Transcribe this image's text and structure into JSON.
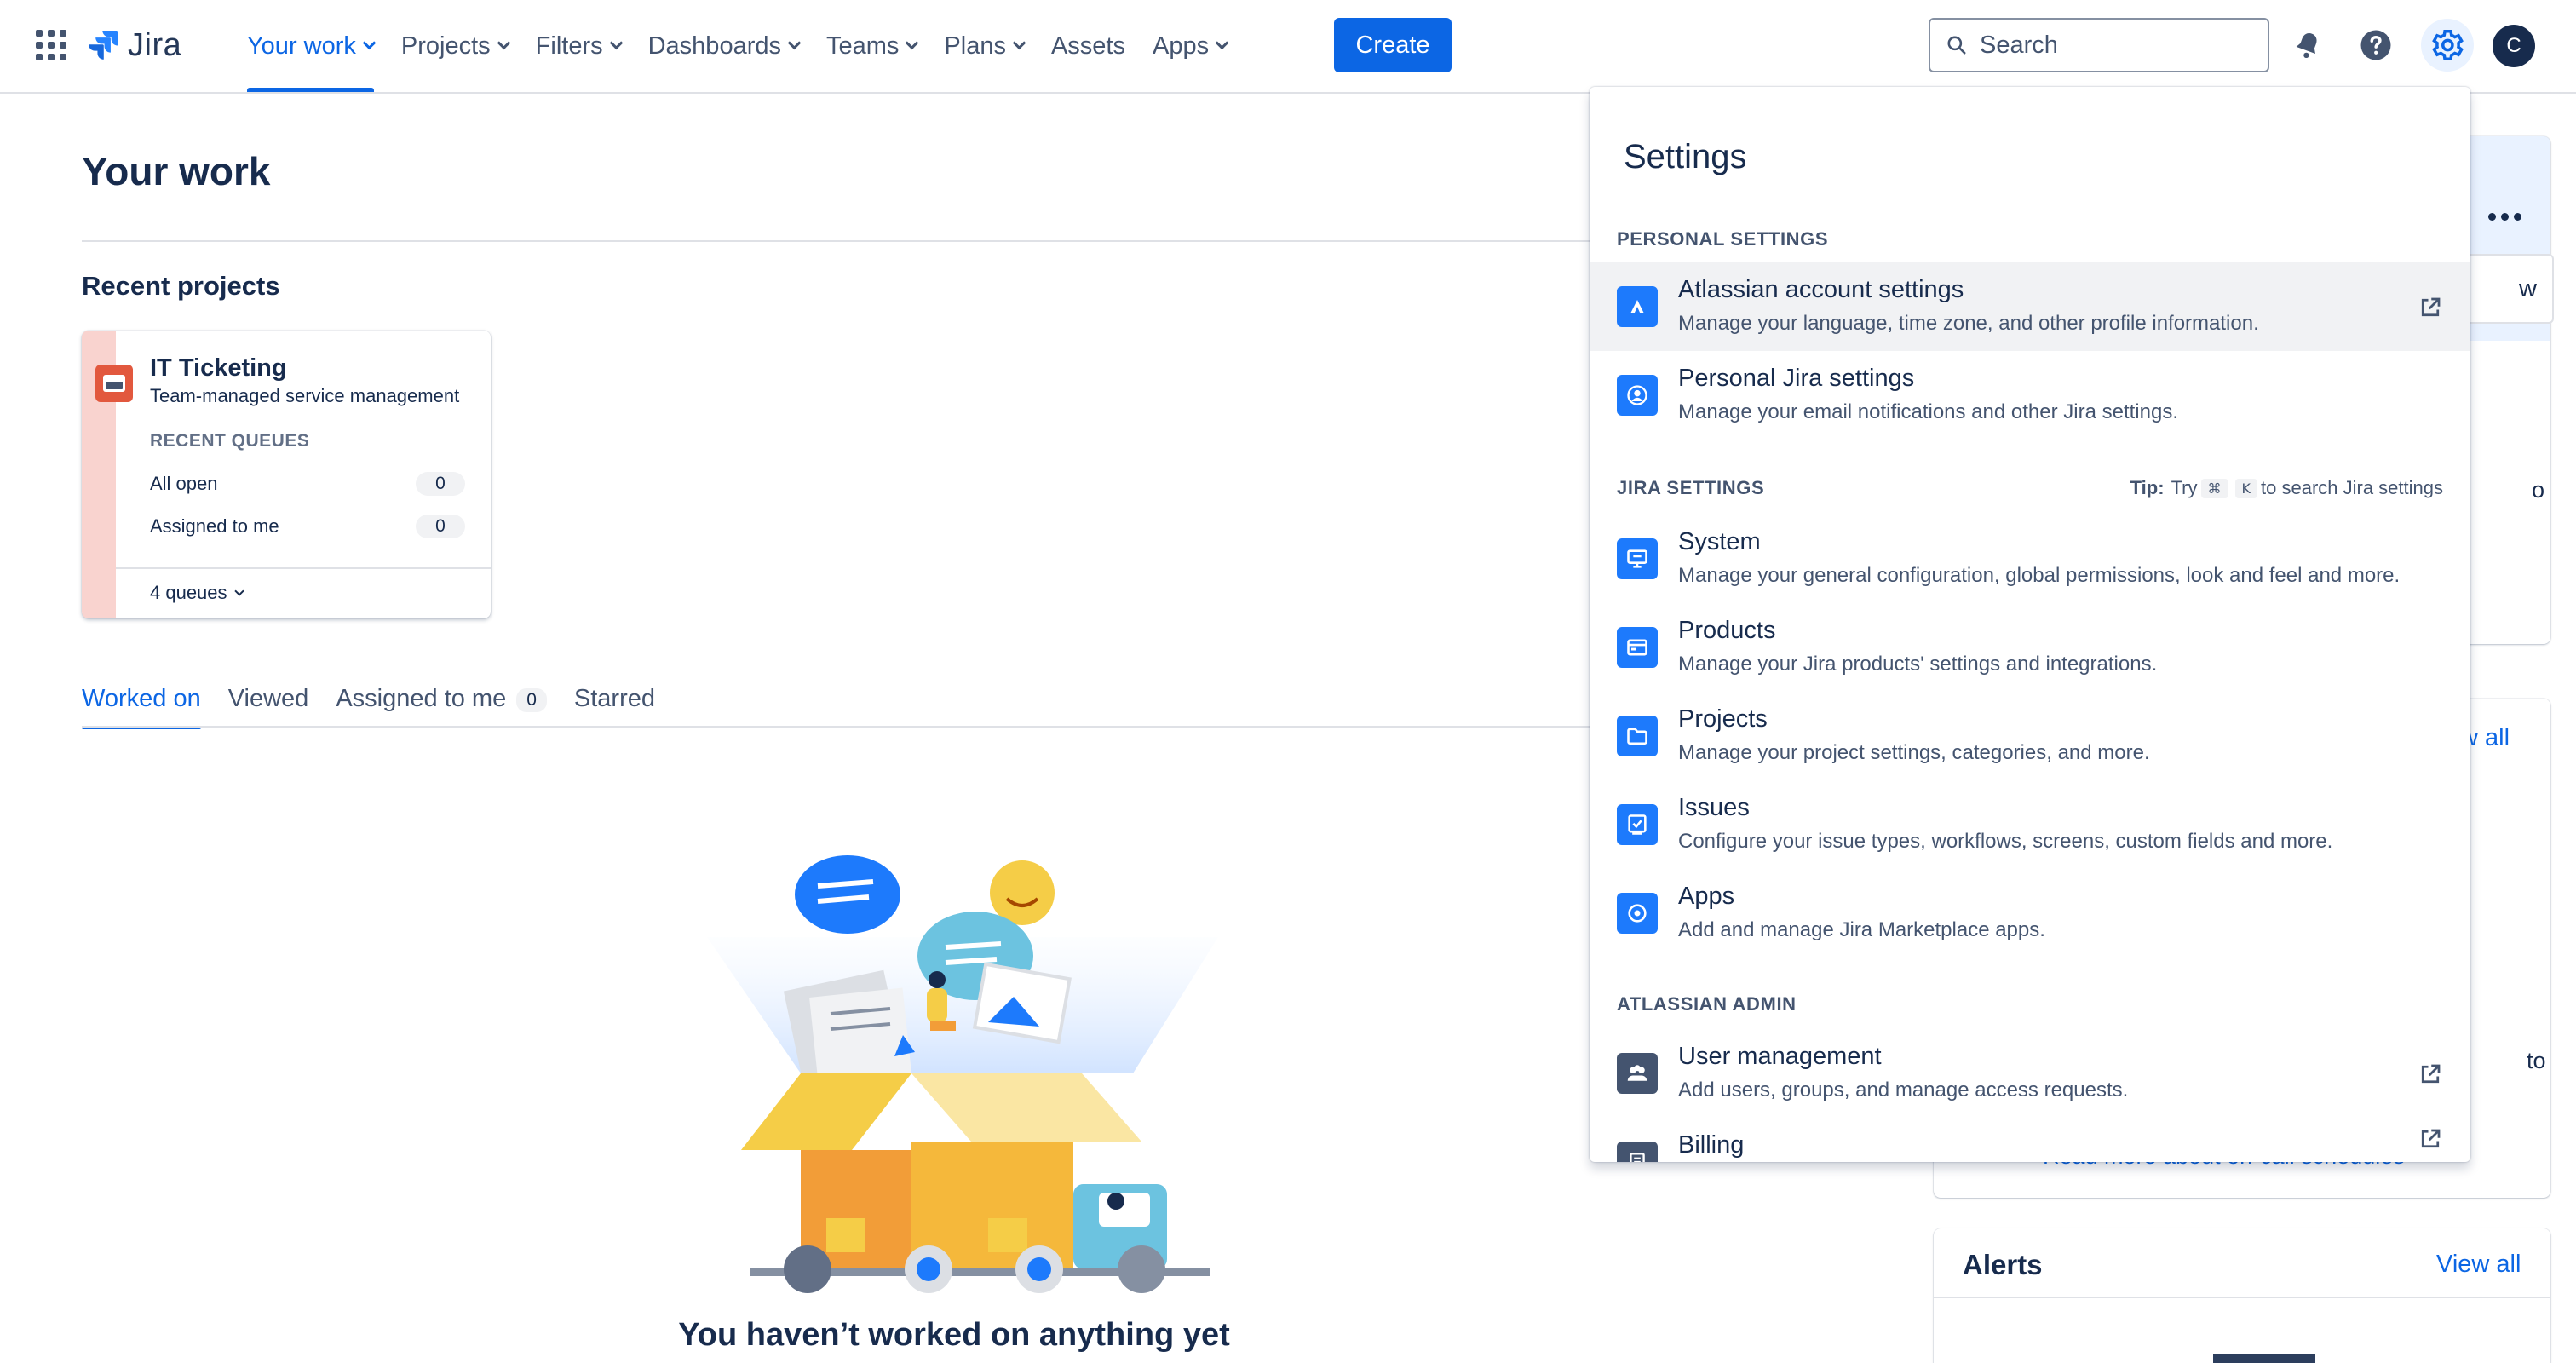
{
  "nav": {
    "logo_text": "Jira",
    "items": [
      {
        "label": "Your work",
        "chevron": true,
        "active": true
      },
      {
        "label": "Projects",
        "chevron": true
      },
      {
        "label": "Filters",
        "chevron": true
      },
      {
        "label": "Dashboards",
        "chevron": true
      },
      {
        "label": "Teams",
        "chevron": true
      },
      {
        "label": "Plans",
        "chevron": true
      },
      {
        "label": "Assets",
        "chevron": false
      },
      {
        "label": "Apps",
        "chevron": true
      }
    ],
    "create_label": "Create",
    "search_placeholder": "Search",
    "avatar_initial": "C",
    "accent": "#0C66E4"
  },
  "main": {
    "title": "Your work",
    "recent_projects_title": "Recent projects",
    "project": {
      "name": "IT Ticketing",
      "type": "Team-managed service management",
      "recent_queues_label": "RECENT QUEUES",
      "queues": [
        {
          "label": "All open",
          "count": "0"
        },
        {
          "label": "Assigned to me",
          "count": "0"
        }
      ],
      "queues_link": "4 queues"
    },
    "tabs": [
      {
        "label": "Worked on",
        "active": true
      },
      {
        "label": "Viewed"
      },
      {
        "label": "Assigned to me",
        "badge": "0"
      },
      {
        "label": "Starred"
      }
    ],
    "empty_title": "You haven’t worked on anything yet"
  },
  "right": {
    "button_fragment": "w",
    "text_fragment_1": "o",
    "view_all_1": "w all",
    "text_fragment_2": "to",
    "link_fragment": "Read more about on-call schedules",
    "alerts_title": "Alerts",
    "alerts_view_all": "View all"
  },
  "settings": {
    "title": "Settings",
    "personal_header": "PERSONAL SETTINGS",
    "personal_items": [
      {
        "name": "Atlassian account settings",
        "desc": "Manage your language, time zone, and other profile information.",
        "icon": "atlassian-icon",
        "external": true
      },
      {
        "name": "Personal Jira settings",
        "desc": "Manage your email notifications and other Jira settings.",
        "icon": "user-circle-icon",
        "external": false
      }
    ],
    "jira_header": "JIRA SETTINGS",
    "tip": {
      "label": "Tip:",
      "pre": "Try",
      "key1": "⌘",
      "key2": "K",
      "post": "to search Jira settings"
    },
    "jira_items": [
      {
        "name": "System",
        "desc": "Manage your general configuration, global permissions, look and feel and more.",
        "icon": "monitor-icon"
      },
      {
        "name": "Products",
        "desc": "Manage your Jira products' settings and integrations.",
        "icon": "products-icon"
      },
      {
        "name": "Projects",
        "desc": "Manage your project settings, categories, and more.",
        "icon": "folder-icon"
      },
      {
        "name": "Issues",
        "desc": "Configure your issue types, workflows, screens, custom fields and more.",
        "icon": "issue-icon"
      },
      {
        "name": "Apps",
        "desc": "Add and manage Jira Marketplace apps.",
        "icon": "apps-target-icon"
      }
    ],
    "admin_header": "ATLASSIAN ADMIN",
    "admin_items": [
      {
        "name": "User management",
        "desc": "Add users, groups, and manage access requests.",
        "icon": "people-icon",
        "external": true
      },
      {
        "name": "Billing",
        "desc": "",
        "icon": "billing-icon",
        "external": true
      }
    ]
  }
}
